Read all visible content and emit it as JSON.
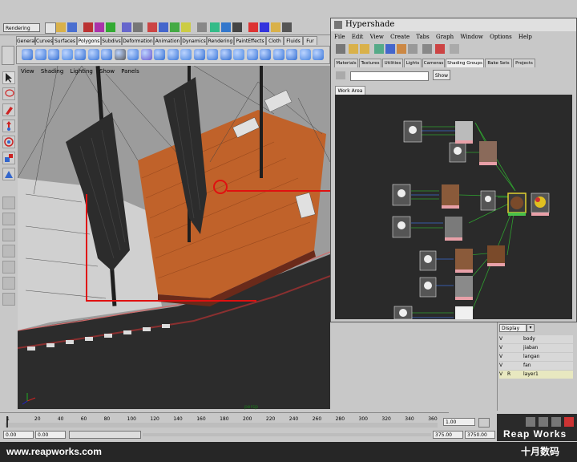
{
  "status_line": {
    "menu_set": "Rendering"
  },
  "shelf": {
    "tabs": [
      "General",
      "Curves",
      "Surfaces",
      "Polygons",
      "Subdivs",
      "Deformation",
      "Animation",
      "Dynamics",
      "Rendering",
      "PaintEffects",
      "Cloth",
      "Fluids",
      "Fur"
    ],
    "active_tab": "Polygons"
  },
  "viewport": {
    "menu": [
      "View",
      "Shading",
      "Lighting",
      "Show",
      "Panels"
    ],
    "camera_label": "persp"
  },
  "hypershade": {
    "title": "Hypershade",
    "menu": [
      "File",
      "Edit",
      "View",
      "Create",
      "Tabs",
      "Graph",
      "Window",
      "Options",
      "Help"
    ],
    "tabs": [
      "Materials",
      "Textures",
      "Utilities",
      "Lights",
      "Cameras",
      "Shading Groups",
      "Bake Sets",
      "Projects"
    ],
    "active_tab": "Shading Groups",
    "search_value": "",
    "show_button": "Show",
    "work_area_tab": "Work Area"
  },
  "layer_editor": {
    "display_label": "Display",
    "layers": [
      {
        "v": "V",
        "r": "",
        "name": "body"
      },
      {
        "v": "V",
        "r": "",
        "name": "jiaban"
      },
      {
        "v": "V",
        "r": "",
        "name": "langan"
      },
      {
        "v": "V",
        "r": "",
        "name": "fan"
      },
      {
        "v": "V",
        "r": "R",
        "name": "layer1"
      }
    ]
  },
  "timeline": {
    "ticks": [
      "1",
      "20",
      "40",
      "60",
      "80",
      "100",
      "120",
      "140",
      "160",
      "180",
      "200",
      "220",
      "240",
      "260",
      "280",
      "300",
      "320",
      "340",
      "360"
    ],
    "current_frame": "1.00"
  },
  "range_slider": {
    "start_time": "0.00",
    "playback_start": "0.00",
    "playback_end": "375.00",
    "end_time": "3750.00"
  },
  "watermark": {
    "url": "www.reapworks.com",
    "logo": "Reap Works",
    "chinese": "十月数码"
  },
  "colors": {
    "deck": "#c0622a",
    "sail": "#2c2c2c",
    "annotation": "#e01010",
    "work_area": "#2a2a2a",
    "connection": "#2fa02f"
  }
}
